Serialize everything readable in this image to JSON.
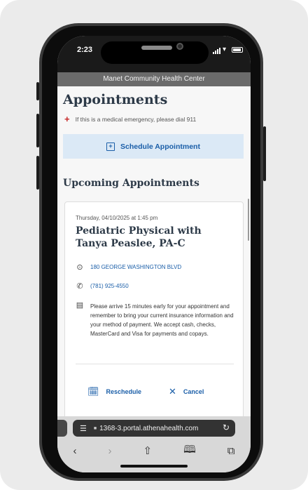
{
  "status": {
    "time": "2:23"
  },
  "site": {
    "header": "Manet Community Health Center"
  },
  "page": {
    "title": "Appointments",
    "emergency_note": "If this is a medical emergency, please dial 911",
    "schedule_button": "Schedule Appointment",
    "upcoming_heading": "Upcoming Appointments"
  },
  "appointment": {
    "datetime": "Thursday, 04/10/2025 at 1:45 pm",
    "title": "Pediatric Physical with Tanya Peaslee, PA-C",
    "address": "180 GEORGE WASHINGTON BLVD",
    "phone": "(781) 925-4550",
    "note": "Please arrive 15 minutes early for your appointment and remember to bring your current insurance information and your method of payment. We accept cash, checks, MasterCard and Visa for payments and copays.",
    "reschedule_label": "Reschedule",
    "cancel_label": "Cancel"
  },
  "browser": {
    "url": "1368-3.portal.athenahealth.com"
  },
  "colors": {
    "accent": "#1a5ea8",
    "button_bg": "#dbe9f6",
    "heading": "#2d3a48",
    "emergency": "#c62828",
    "site_header": "#6b6b6b"
  },
  "icons": {
    "emergency": "plus-icon",
    "schedule": "calendar-plus-icon",
    "address": "location-pin-icon",
    "phone": "phone-icon",
    "note": "note-icon",
    "reschedule": "calendar-icon",
    "cancel": "close-icon",
    "browser_nav": [
      "back-icon",
      "forward-icon",
      "share-icon",
      "bookmarks-icon",
      "tabs-icon"
    ]
  }
}
